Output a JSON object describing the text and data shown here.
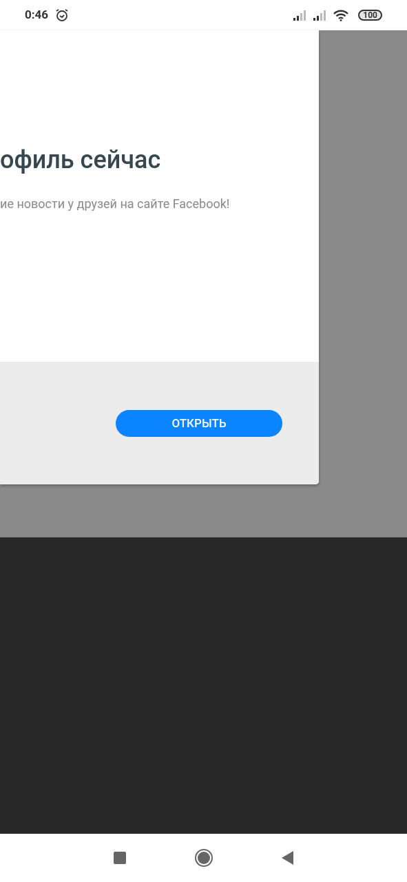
{
  "status_bar": {
    "time": "0:46",
    "battery": "100"
  },
  "dialog": {
    "title": "офиль сейчас",
    "subtitle": "ие новости у друзей на сайте Facebook!",
    "button": "ОТКРЫТЬ"
  }
}
